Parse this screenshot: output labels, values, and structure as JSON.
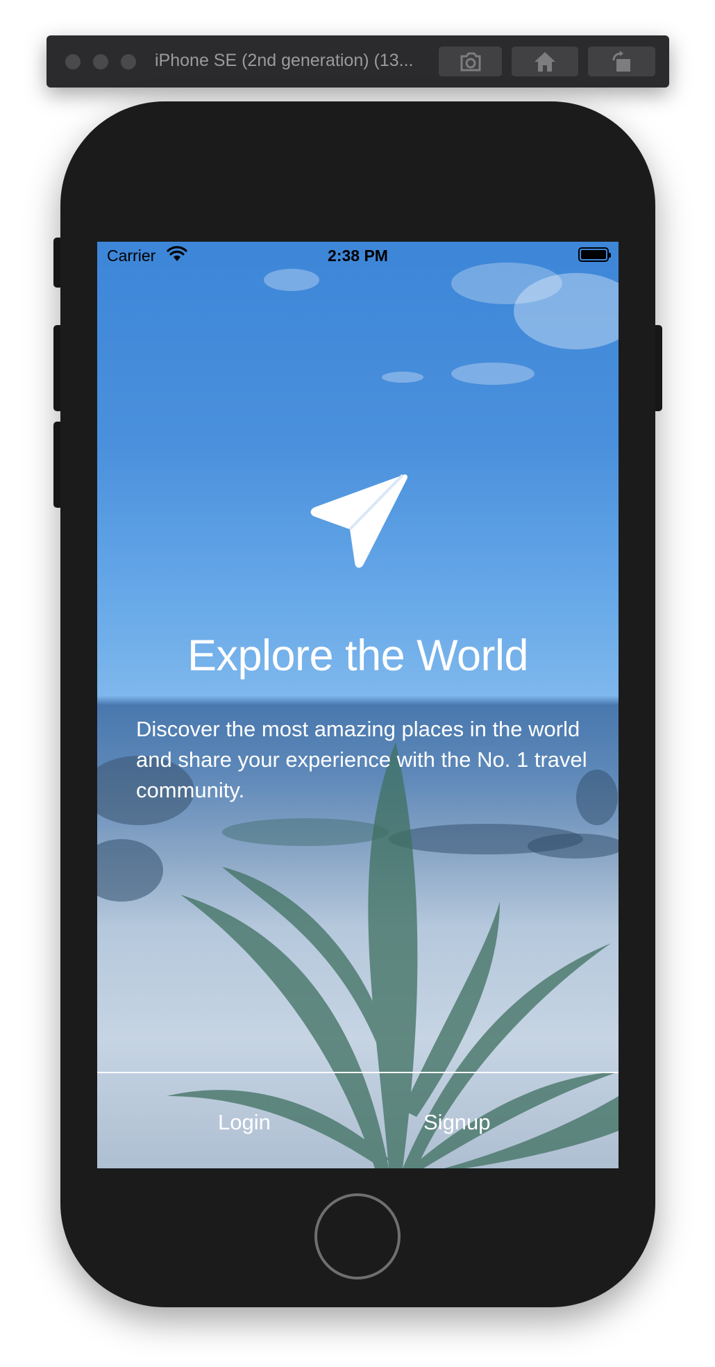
{
  "simulator": {
    "title": "iPhone SE (2nd generation) (13...",
    "toolbar_icons": [
      "screenshot-camera-icon",
      "home-icon",
      "rotate-icon"
    ]
  },
  "status_bar": {
    "carrier": "Carrier",
    "time": "2:38 PM",
    "wifi_icon": "wifi-icon",
    "battery_level": 1.0
  },
  "onboarding": {
    "logo_icon": "paper-plane-icon",
    "title": "Explore the World",
    "description": "Discover the most amazing places in the world and share your experience with the No. 1 travel community.",
    "login_label": "Login",
    "signup_label": "Signup"
  },
  "colors": {
    "text": "#ffffff",
    "device_body": "#1b1b1c",
    "sky": "#4a90dc"
  }
}
